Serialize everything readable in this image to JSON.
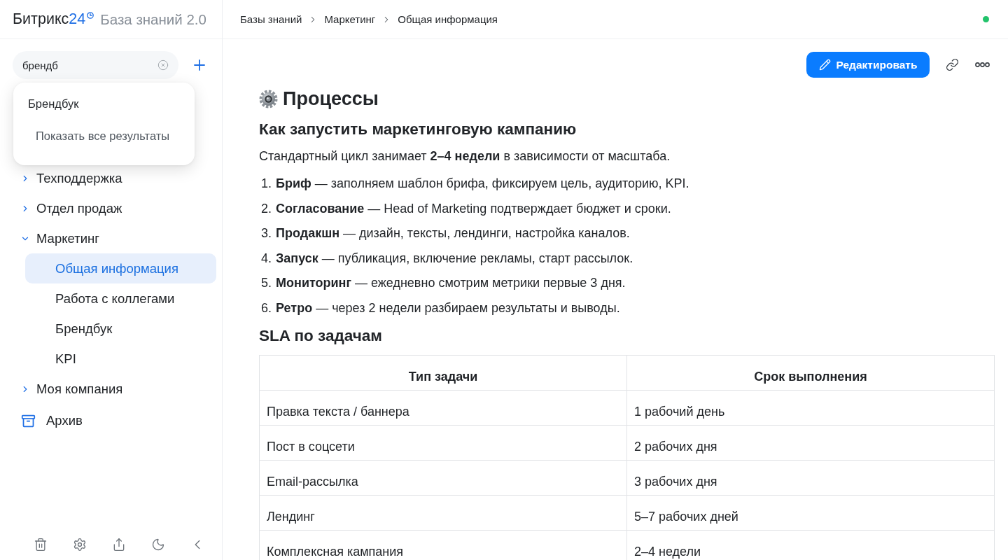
{
  "app": {
    "logo": {
      "name": "Битрикс",
      "number": "24"
    },
    "title": "База знаний 2.0"
  },
  "breadcrumbs": [
    "Базы знаний",
    "Маркетинг",
    "Общая информация"
  ],
  "online": true,
  "sidebar": {
    "search": {
      "value": "брендб"
    },
    "search_results": {
      "items": [
        "Брендбук"
      ],
      "show_all": "Показать все результаты"
    },
    "tree": [
      {
        "label": "Техподдержка",
        "expanded": false,
        "selected": false
      },
      {
        "label": "Отдел продаж",
        "expanded": false,
        "selected": false
      },
      {
        "label": "Маркетинг",
        "expanded": true,
        "selected": false,
        "children": [
          {
            "label": "Общая информация",
            "selected": true
          },
          {
            "label": "Работа с коллегами",
            "selected": false
          },
          {
            "label": "Брендбук",
            "selected": false
          },
          {
            "label": "KPI",
            "selected": false
          }
        ]
      },
      {
        "label": "Моя компания",
        "expanded": false,
        "selected": false
      }
    ],
    "archive": "Архив"
  },
  "toolbar": {
    "edit": "Редактировать"
  },
  "article": {
    "title": "Процессы",
    "heading": "Как запустить маркетинговую кампанию",
    "intro": "Стандартный цикл занимает **2–4 недели** в зависимости от масштаба.",
    "steps": [
      {
        "number": "1.",
        "text": "**Бриф** — заполняем шаблон брифа, фиксируем цель, аудиторию, KPI."
      },
      {
        "number": "2.",
        "text": "**Согласование** — Head of Marketing подтверждает бюджет и сроки."
      },
      {
        "number": "3.",
        "text": "**Продакшн** — дизайн, тексты, лендинги, настройка каналов."
      },
      {
        "number": "4.",
        "text": "**Запуск** — публикация, включение рекламы, старт рассылок."
      },
      {
        "number": "5.",
        "text": "**Мониторинг** — ежедневно смотрим метрики первые 3 дня."
      },
      {
        "number": "6.",
        "text": "**Ретро** — через 2 недели разбираем результаты и выводы."
      }
    ],
    "table_heading": "SLA по задачам",
    "table": {
      "columns": [
        "Тип задачи",
        "Срок выполнения"
      ],
      "rows": [
        [
          "Правка текста / баннера",
          "1 рабочий день"
        ],
        [
          "Пост в соцсети",
          "2 рабочих дня"
        ],
        [
          "Email-рассылка",
          "3 рабочих дня"
        ],
        [
          "Лендинг",
          "5–7 рабочих дней"
        ],
        [
          "Комплексная кампания",
          "2–4 недели"
        ]
      ]
    }
  }
}
